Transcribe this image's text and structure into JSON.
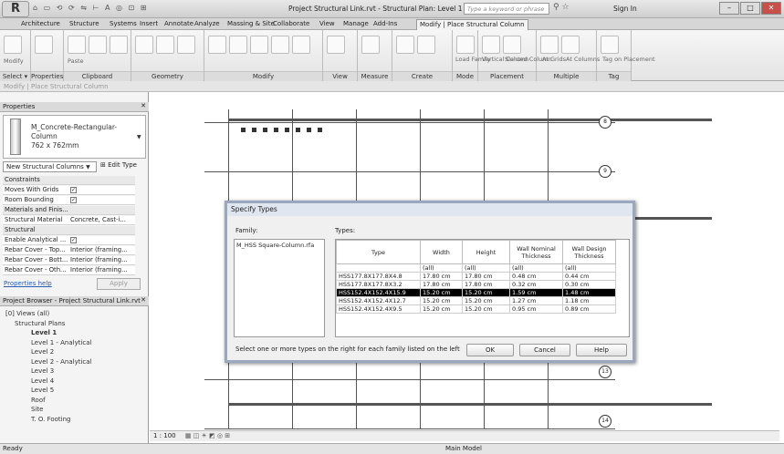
{
  "app": {
    "logo": "R",
    "title": "Project Structural Link.rvt - Structural Plan: Level 1",
    "search_placeholder": "Type a keyword or phrase",
    "signin": "Sign In",
    "qat": "⌂ ▭ ⟲ ⟳ ⇋ ⊢ A ◎ ⊡ ⊞"
  },
  "tabs": [
    "Architecture",
    "Structure",
    "Systems",
    "Insert",
    "Annotate",
    "Analyze",
    "Massing & Site",
    "Collaborate",
    "View",
    "Manage",
    "Add-Ins",
    "Modify | Place Structural Column"
  ],
  "ribbon": {
    "panels": [
      "Select ▾",
      "Properties",
      "Clipboard",
      "Geometry",
      "Modify",
      "View",
      "Measure",
      "Create",
      "Mode",
      "Placement",
      "Multiple",
      "Tag"
    ],
    "items": {
      "modify": "Modify",
      "paste": "Paste",
      "cut": "Cut",
      "cope": "Cope",
      "join": "Join",
      "load_family": "Load Family",
      "vertical_column": "Vertical Column",
      "slanted_column": "Slanted Column",
      "at_grids": "At Grids",
      "at_columns": "At Columns",
      "tag_on_placement": "Tag on Placement"
    }
  },
  "context_bar": "Modify | Place Structural Column",
  "properties": {
    "header": "Properties",
    "type_name": "M_Concrete-Rectangular-Column",
    "type_size": "762 x 762mm",
    "selector": "New Structural Columns",
    "edit_type": "Edit Type",
    "rows": [
      {
        "k": "Constraints",
        "v": "",
        "sec": true
      },
      {
        "k": "Moves With Grids",
        "v": "✓",
        "sec": false
      },
      {
        "k": "Room Bounding",
        "v": "✓",
        "sec": false
      },
      {
        "k": "Materials and Finis...",
        "v": "",
        "sec": true
      },
      {
        "k": "Structural Material",
        "v": "Concrete, Cast-i...",
        "sec": false
      },
      {
        "k": "Structural",
        "v": "",
        "sec": true
      },
      {
        "k": "Enable Analytical ...",
        "v": "✓",
        "sec": false
      },
      {
        "k": "Rebar Cover - Top...",
        "v": "Interior (framing...",
        "sec": false
      },
      {
        "k": "Rebar Cover - Bott...",
        "v": "Interior (framing...",
        "sec": false
      },
      {
        "k": "Rebar Cover - Oth...",
        "v": "Interior (framing...",
        "sec": false
      }
    ],
    "help": "Properties help",
    "apply": "Apply"
  },
  "browser": {
    "header": "Project Browser - Project Structural Link.rvt",
    "items": [
      "[0] Views (all)",
      "Structural Plans",
      "Level 1",
      "Level 1 - Analytical",
      "Level 2",
      "Level 2 - Analytical",
      "Level 3",
      "Level 4",
      "Level 5",
      "Roof",
      "Site",
      "T. O. Footing"
    ]
  },
  "dialog": {
    "title": "Specify Types",
    "family_label": "Family:",
    "types_label": "Types:",
    "families": [
      "M_HSS Square-Column.rfa"
    ],
    "columns": [
      "Type",
      "Width",
      "Height",
      "Wall Nominal Thickness",
      "Wall Design Thickness"
    ],
    "filter": "(all)",
    "rows": [
      [
        "HSS177.8X177.8X4.8",
        "17.80 cm",
        "17.80 cm",
        "0.48 cm",
        "0.44 cm"
      ],
      [
        "HSS177.8X177.8X3.2",
        "17.80 cm",
        "17.80 cm",
        "0.32 cm",
        "0.30 cm"
      ],
      [
        "HSS152.4X152.4X15.9",
        "15.20 cm",
        "15.20 cm",
        "1.59 cm",
        "1.48 cm"
      ],
      [
        "HSS152.4X152.4X12.7",
        "15.20 cm",
        "15.20 cm",
        "1.27 cm",
        "1.18 cm"
      ],
      [
        "HSS152.4X152.4X9.5",
        "15.20 cm",
        "15.20 cm",
        "0.95 cm",
        "0.89 cm"
      ]
    ],
    "selected_row": 2,
    "hint": "Select one or more types on the right for each family listed on the left",
    "ok": "OK",
    "cancel": "Cancel",
    "help": "Help"
  },
  "canvas": {
    "grid_bubbles": [
      "8",
      "9",
      "13",
      "14"
    ]
  },
  "view_control": {
    "scale": "1 : 100"
  },
  "status": {
    "text": "Ready",
    "model": "Main Model"
  }
}
